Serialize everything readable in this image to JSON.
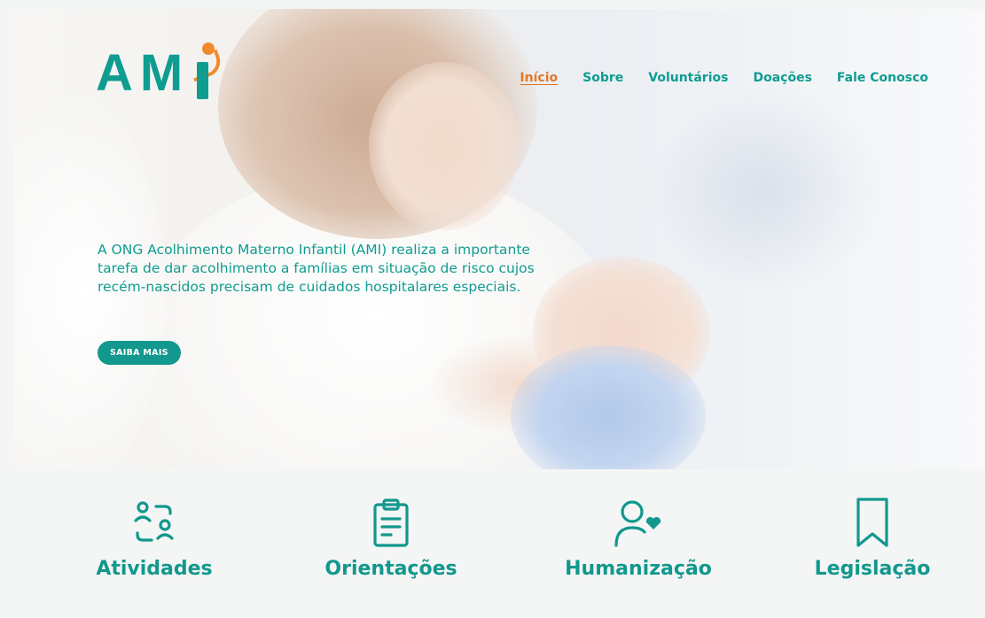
{
  "brand": {
    "logo_text": "AM",
    "logo_accent_color": "#f08a2c",
    "primary_color": "#12988d"
  },
  "nav": {
    "items": [
      {
        "label": "Início",
        "active": true
      },
      {
        "label": "Sobre"
      },
      {
        "label": "Voluntários"
      },
      {
        "label": "Doações"
      },
      {
        "label": "Fale Conosco"
      }
    ]
  },
  "hero": {
    "description": "A ONG Acolhimento Materno Infantil (AMI) realiza a importante tarefa de dar acolhimento a famílias em situação de risco cujos recém-nascidos precisam de cuidados hospitalares especiais.",
    "cta_label": "SAIBA MAIS"
  },
  "features": [
    {
      "label": "Atividades",
      "icon": "people-swap-icon"
    },
    {
      "label": "Orientações",
      "icon": "clipboard-icon"
    },
    {
      "label": "Humanização",
      "icon": "person-heart-icon"
    },
    {
      "label": "Legislação",
      "icon": "bookmark-icon"
    }
  ]
}
